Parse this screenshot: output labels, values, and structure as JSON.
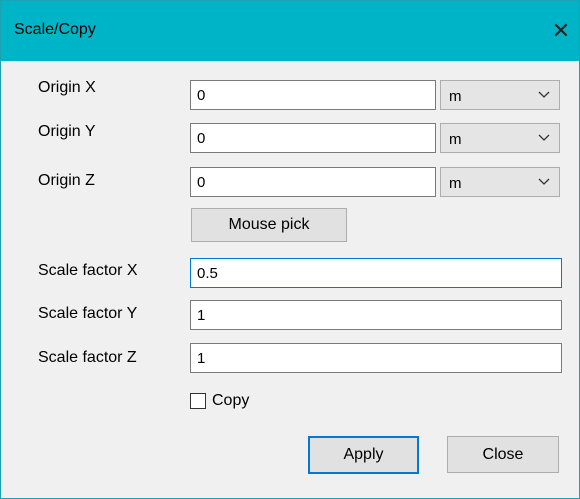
{
  "window": {
    "title": "Scale/Copy",
    "close_glyph": "✕"
  },
  "origin": {
    "x_label": "Origin X",
    "x_value": "0",
    "x_unit": "m",
    "y_label": "Origin Y",
    "y_value": "0",
    "y_unit": "m",
    "z_label": "Origin Z",
    "z_value": "0",
    "z_unit": "m"
  },
  "mouse_pick_label": "Mouse pick",
  "scale": {
    "x_label": "Scale factor X",
    "x_value": "0.5",
    "y_label": "Scale factor Y",
    "y_value": "1",
    "z_label": "Scale factor Z",
    "z_value": "1"
  },
  "copy": {
    "label": "Copy",
    "checked": false
  },
  "buttons": {
    "apply": "Apply",
    "close": "Close"
  },
  "colors": {
    "titlebar": "#00b4c8",
    "focus_border": "#0078d7",
    "background_shape": "#1515d8"
  },
  "icons": {
    "close": "close-icon",
    "dropdown": "chevron-down-icon"
  }
}
